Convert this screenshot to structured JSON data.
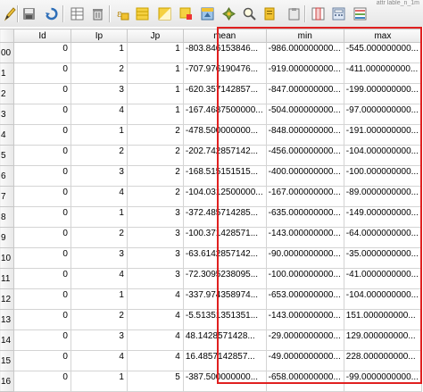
{
  "window_title_fragment": "attr lable_n_1m",
  "toolbar": {
    "icons": [
      "pencil-edit-icon",
      "save-edits-icon",
      "reload-icon",
      "new-feature-icon",
      "delete-feature-icon",
      "select-by-expression-icon",
      "select-all-icon",
      "invert-selection-icon",
      "deselect-all-icon",
      "move-selection-top-icon",
      "pan-to-selected-icon",
      "zoom-to-selected-icon",
      "copy-rows-icon",
      "paste-features-icon",
      "delete-column-icon",
      "field-calculator-icon",
      "conditional-format-icon"
    ]
  },
  "table": {
    "columns": [
      "Id",
      "Ip",
      "Jp",
      "mean",
      "min",
      "max"
    ],
    "rows": [
      {
        "hdr": "00",
        "Id": "0",
        "Ip": "1",
        "Jp": "1",
        "mean": "-803.846153846...",
        "min": "-986.000000000...",
        "max": "-545.000000000..."
      },
      {
        "hdr": "1",
        "Id": "0",
        "Ip": "2",
        "Jp": "1",
        "mean": "-707.976190476...",
        "min": "-919.000000000...",
        "max": "-411.000000000..."
      },
      {
        "hdr": "2",
        "Id": "0",
        "Ip": "3",
        "Jp": "1",
        "mean": "-620.357142857...",
        "min": "-847.000000000...",
        "max": "-199.000000000..."
      },
      {
        "hdr": "3",
        "Id": "0",
        "Ip": "4",
        "Jp": "1",
        "mean": "-167.4687500000...",
        "min": "-504.000000000...",
        "max": "-97.0000000000..."
      },
      {
        "hdr": "4",
        "Id": "0",
        "Ip": "1",
        "Jp": "2",
        "mean": "-478.500000000...",
        "min": "-848.000000000...",
        "max": "-191.000000000..."
      },
      {
        "hdr": "5",
        "Id": "0",
        "Ip": "2",
        "Jp": "2",
        "mean": "-202.742857142...",
        "min": "-456.000000000...",
        "max": "-104.000000000..."
      },
      {
        "hdr": "6",
        "Id": "0",
        "Ip": "3",
        "Jp": "2",
        "mean": "-168.515151515...",
        "min": "-400.000000000...",
        "max": "-100.000000000..."
      },
      {
        "hdr": "7",
        "Id": "0",
        "Ip": "4",
        "Jp": "2",
        "mean": "-104.0312500000...",
        "min": "-167.000000000...",
        "max": "-89.0000000000..."
      },
      {
        "hdr": "8",
        "Id": "0",
        "Ip": "1",
        "Jp": "3",
        "mean": "-372.485714285...",
        "min": "-635.000000000...",
        "max": "-149.000000000..."
      },
      {
        "hdr": "9",
        "Id": "0",
        "Ip": "2",
        "Jp": "3",
        "mean": "-100.371428571...",
        "min": "-143.000000000...",
        "max": "-64.0000000000..."
      },
      {
        "hdr": "10",
        "Id": "0",
        "Ip": "3",
        "Jp": "3",
        "mean": "-63.6142857142...",
        "min": "-90.0000000000...",
        "max": "-35.0000000000..."
      },
      {
        "hdr": "11",
        "Id": "0",
        "Ip": "4",
        "Jp": "3",
        "mean": "-72.3095238095...",
        "min": "-100.000000000...",
        "max": "-41.0000000000..."
      },
      {
        "hdr": "12",
        "Id": "0",
        "Ip": "1",
        "Jp": "4",
        "mean": "-337.974358974...",
        "min": "-653.000000000...",
        "max": "-104.000000000..."
      },
      {
        "hdr": "13",
        "Id": "0",
        "Ip": "2",
        "Jp": "4",
        "mean": "-5.51351351351...",
        "min": "-143.000000000...",
        "max": "151.000000000..."
      },
      {
        "hdr": "14",
        "Id": "0",
        "Ip": "3",
        "Jp": "4",
        "mean": "48.1428571428...",
        "min": "-29.0000000000...",
        "max": "129.000000000..."
      },
      {
        "hdr": "15",
        "Id": "0",
        "Ip": "4",
        "Jp": "4",
        "mean": "16.4857142857...",
        "min": "-49.0000000000...",
        "max": "228.000000000..."
      },
      {
        "hdr": "16",
        "Id": "0",
        "Ip": "1",
        "Jp": "5",
        "mean": "-387.500000000...",
        "min": "-658.000000000...",
        "max": "-99.0000000000..."
      }
    ]
  },
  "highlight_color": "#e02020"
}
